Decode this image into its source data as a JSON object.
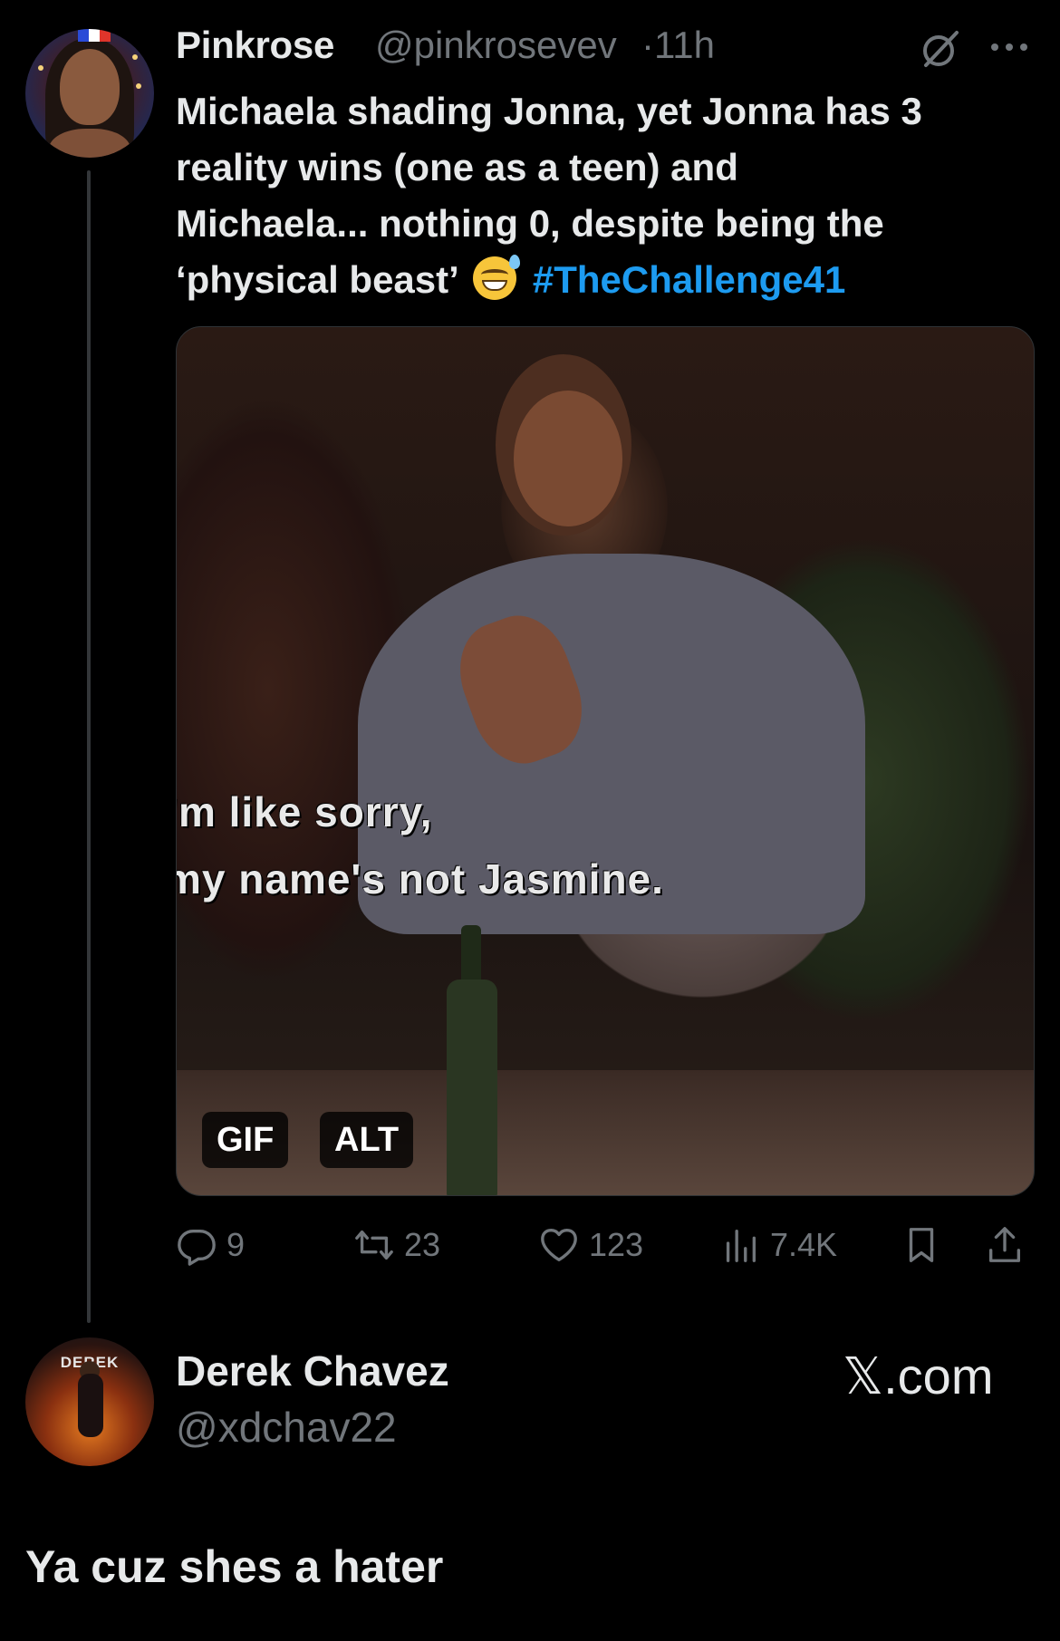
{
  "tweet": {
    "author_name": "Pinkrose",
    "handle": "@pinkrosevev",
    "separator": "·",
    "time": "11h",
    "text_lines": [
      "Michaela shading Jonna, yet Jonna has 3",
      "reality wins (one as a teen) and",
      "Michaela... nothing 0, despite being the",
      "‘physical beast’"
    ],
    "hashtag": "#TheChallenge41",
    "emoji_icon": "grinning-sweat-emoji",
    "media": {
      "caption_line1": "'m like sorry,",
      "caption_line2": "my name's not Jasmine.",
      "badge_gif": "GIF",
      "badge_alt": "ALT"
    },
    "stats": {
      "replies": "9",
      "retweets": "23",
      "likes": "123",
      "views": "7.4K"
    }
  },
  "reply": {
    "author_name": "Derek Chavez",
    "handle": "@xdchav22",
    "avatar_label": "DEREK",
    "source": "𝕏.com",
    "text": "Ya cuz shes a hater"
  },
  "colors": {
    "background": "#000000",
    "text": "#e7e9ea",
    "muted": "#71767b",
    "accent": "#1d9bf0"
  }
}
